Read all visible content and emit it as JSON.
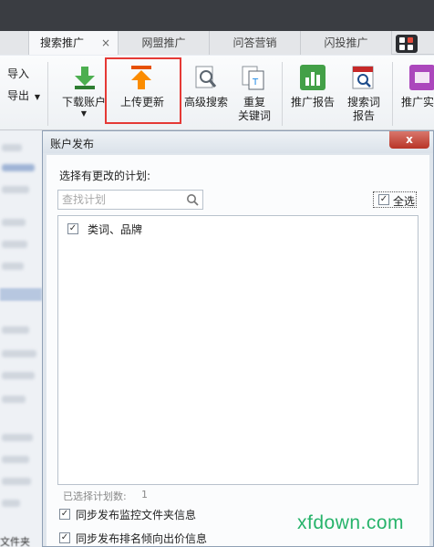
{
  "tabs": [
    {
      "label": "搜索推广",
      "active": true,
      "close": "×"
    },
    {
      "label": "网盟推广",
      "active": false
    },
    {
      "label": "问答营销",
      "active": false
    },
    {
      "label": "闪投推广",
      "active": false
    }
  ],
  "left_menu": {
    "import_label": "导入",
    "export_label": "导出"
  },
  "toolbar": {
    "download_label": "下载账户",
    "upload_label": "上传更新",
    "adv_search_label": "高级搜索",
    "dup_kw_label_1": "重复",
    "dup_kw_label_2": "关键词",
    "report_label": "推广报告",
    "search_term_label_1": "搜索词",
    "search_term_label_2": "报告",
    "more_label": "推广实"
  },
  "dialog": {
    "title": "账户发布",
    "close": "x",
    "section_label": "选择有更改的计划:",
    "search_placeholder": "查找计划",
    "select_all_label": "全选",
    "plans": [
      {
        "label": "类词、品牌",
        "checked": true
      }
    ],
    "selected_count_label": "已选择计划数:",
    "selected_count": "1",
    "options": [
      {
        "label": "同步发布监控文件夹信息",
        "checked": true
      },
      {
        "label": "同步发布排名倾向出价信息",
        "checked": true
      }
    ]
  },
  "left_panel": {
    "bottom_text": "文件夹"
  },
  "watermark": "xfdown.com",
  "colors": {
    "highlight_border": "#e53935",
    "download_icon": "#4caf50",
    "upload_icon": "#f57c00",
    "report_icon": "#43a047",
    "close_button": "#c0392b",
    "watermark": "#26b36a"
  }
}
